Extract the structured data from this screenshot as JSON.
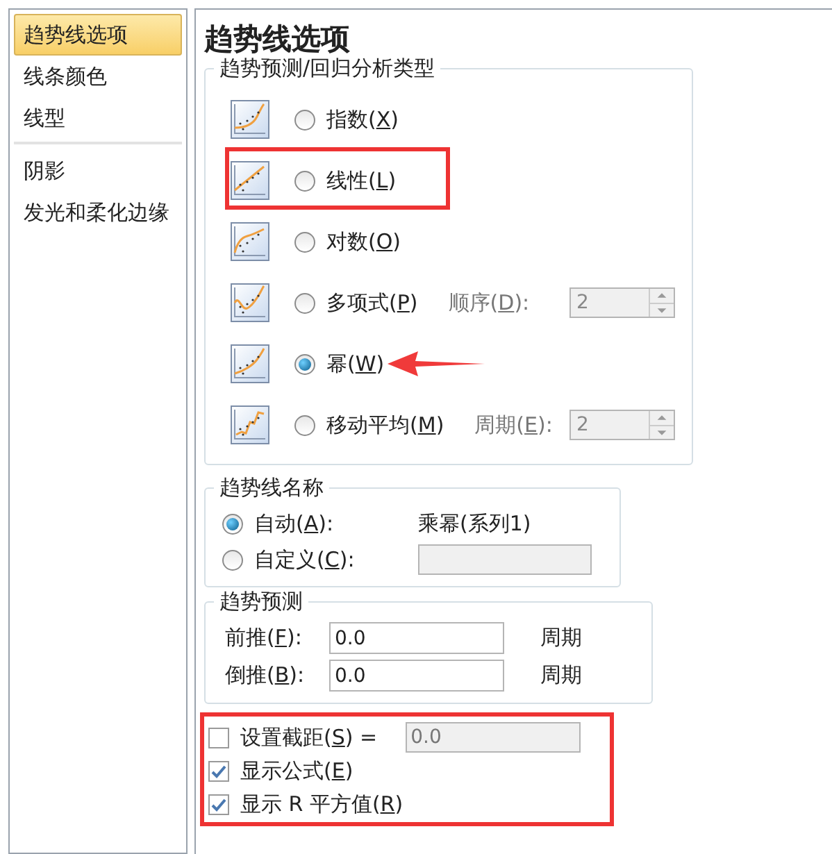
{
  "sidebar": {
    "groups": [
      [
        {
          "label": "趋势线选项",
          "selected": true
        },
        {
          "label": "线条颜色",
          "selected": false
        },
        {
          "label": "线型",
          "selected": false
        }
      ],
      [
        {
          "label": "阴影",
          "selected": false
        },
        {
          "label": "发光和柔化边缘",
          "selected": false
        }
      ]
    ]
  },
  "title": "趋势线选项",
  "regression": {
    "legend": "趋势预测/回归分析类型",
    "types": [
      {
        "kind": "exponential",
        "label": "指数(X)",
        "selected": false,
        "highlighted": false,
        "arrow": false
      },
      {
        "kind": "linear",
        "label": "线性(L)",
        "selected": false,
        "highlighted": true,
        "arrow": false
      },
      {
        "kind": "log",
        "label": "对数(O)",
        "selected": false,
        "highlighted": false,
        "arrow": false
      },
      {
        "kind": "poly",
        "label": "多项式(P)",
        "selected": false,
        "highlighted": false,
        "arrow": false,
        "option": {
          "label": "顺序(D):",
          "value": "2"
        }
      },
      {
        "kind": "power",
        "label": "幂(W)",
        "selected": true,
        "highlighted": false,
        "arrow": true
      },
      {
        "kind": "moving",
        "label": "移动平均(M)",
        "selected": false,
        "highlighted": false,
        "arrow": false,
        "option": {
          "label": "周期(E):",
          "value": "2"
        }
      }
    ]
  },
  "name_group": {
    "legend": "趋势线名称",
    "options": [
      {
        "label": "自动(A):",
        "selected": true,
        "value": "乘幂(系列1)"
      },
      {
        "label": "自定义(C):",
        "selected": false,
        "field": true
      }
    ]
  },
  "forecast": {
    "legend": "趋势预测",
    "rows": [
      {
        "label": "前推(F):",
        "value": "0.0",
        "unit": "周期"
      },
      {
        "label": "倒推(B):",
        "value": "0.0",
        "unit": "周期"
      }
    ]
  },
  "checks": {
    "highlighted": true,
    "items": [
      {
        "label": "设置截距(S) =",
        "checked": false,
        "value": "0.0"
      },
      {
        "label": "显示公式(E)",
        "checked": true
      },
      {
        "label": "显示 R 平方值(R)",
        "checked": true
      }
    ]
  }
}
